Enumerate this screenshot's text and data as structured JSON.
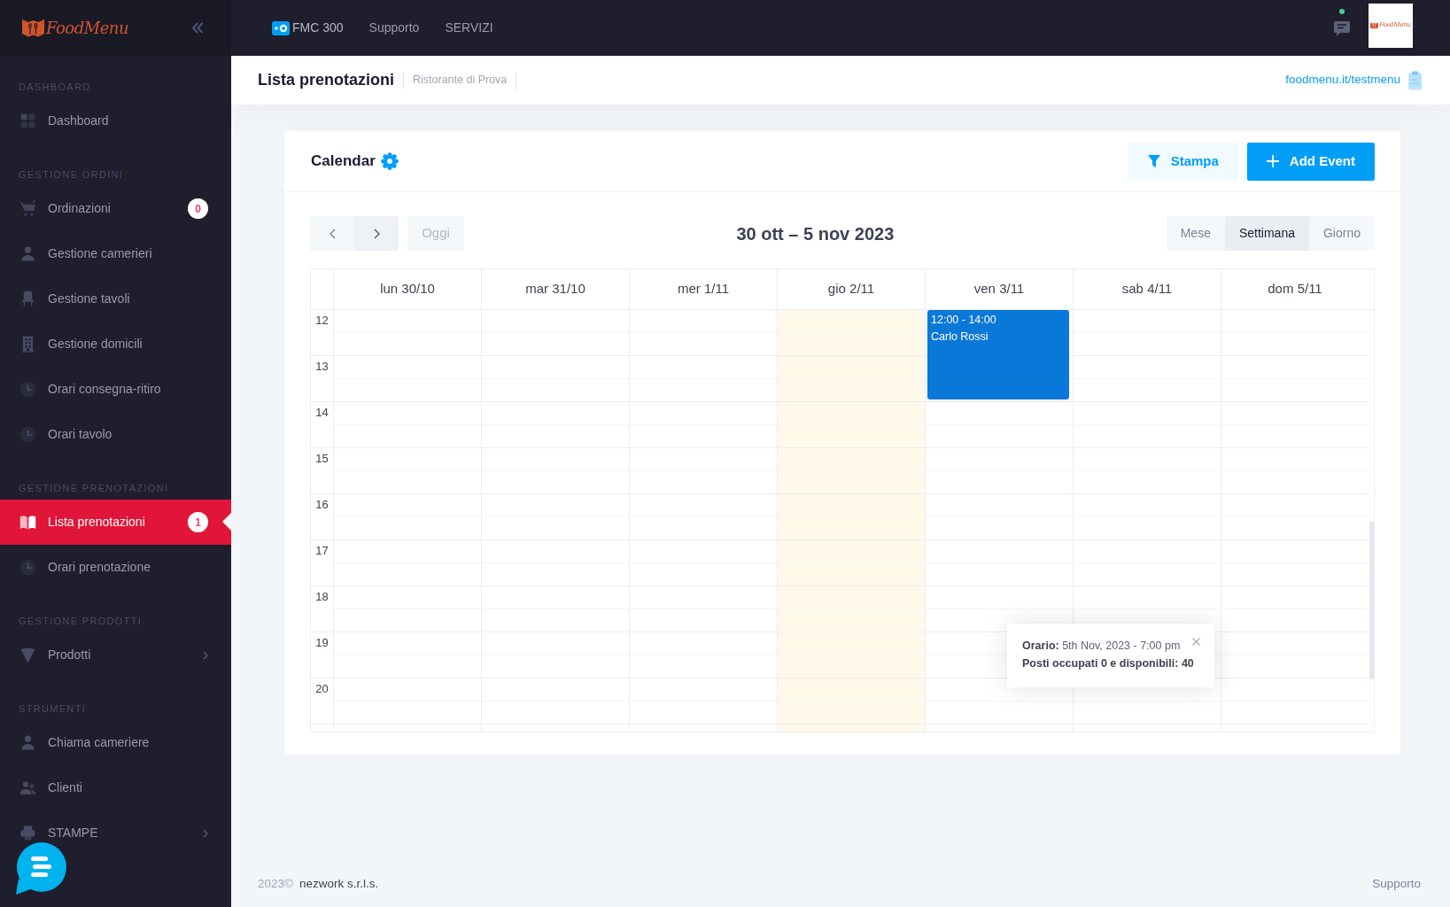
{
  "sidebar": {
    "logo": "FoodMenu",
    "sections": [
      {
        "label": "DASHBOARD",
        "items": [
          {
            "label": "Dashboard",
            "selected": false,
            "has_submenu": false
          }
        ]
      },
      {
        "label": "GESTIONE ORDINI",
        "items": [
          {
            "label": "Ordinazioni",
            "badge": "0",
            "selected": false,
            "has_submenu": false
          },
          {
            "label": "Gestione camerieri",
            "selected": false,
            "has_submenu": false
          },
          {
            "label": "Gestione tavoli",
            "selected": false,
            "has_submenu": false
          },
          {
            "label": "Gestione domicili",
            "selected": false,
            "has_submenu": false
          },
          {
            "label": "Orari consegna-ritiro",
            "selected": false,
            "has_submenu": false
          },
          {
            "label": "Orari tavolo",
            "selected": false,
            "has_submenu": false
          }
        ]
      },
      {
        "label": "GESTIONE PRENOTAZIONI",
        "items": [
          {
            "label": "Lista prenotazioni",
            "badge": "1",
            "selected": true,
            "has_submenu": false
          },
          {
            "label": "Orari prenotazione",
            "selected": false,
            "has_submenu": false
          }
        ]
      },
      {
        "label": "GESTIONE PRODOTTI",
        "items": [
          {
            "label": "Prodotti",
            "selected": false,
            "has_submenu": true
          }
        ]
      },
      {
        "label": "STRUMENTI",
        "items": [
          {
            "label": "Chiama cameriere",
            "selected": false,
            "has_submenu": false
          },
          {
            "label": "Clienti",
            "selected": false,
            "has_submenu": false
          },
          {
            "label": "STAMPE",
            "selected": false,
            "has_submenu": true
          }
        ]
      }
    ]
  },
  "topbar": {
    "nav": [
      {
        "label": "FMC 300"
      },
      {
        "label": "Supporto"
      },
      {
        "label": "SERVIZI"
      }
    ],
    "notifications": {
      "unread": true
    },
    "account": {
      "logo": "FoodMenu"
    }
  },
  "page_header": {
    "title": "Lista prenotazioni",
    "subtitle": "Ristorante di Prova",
    "menu_link": "foodmenu.it/testmenu"
  },
  "calendar": {
    "title": "Calendar",
    "buttons": [
      {
        "label": "Stampa",
        "kind": "secondary"
      },
      {
        "label": "Add Event",
        "kind": "primary"
      }
    ],
    "today_button": {
      "label": "Oggi",
      "disabled": true
    },
    "range": "30 ott – 5 nov 2023",
    "views": [
      {
        "label": "Mese",
        "selected": false
      },
      {
        "label": "Settimana",
        "selected": true
      },
      {
        "label": "Giorno",
        "selected": false
      }
    ],
    "days": [
      {
        "label": "lun 30/10",
        "today": false
      },
      {
        "label": "mar 31/10",
        "today": false
      },
      {
        "label": "mer 1/11",
        "today": false
      },
      {
        "label": "gio 2/11",
        "today": true
      },
      {
        "label": "ven 3/11",
        "today": false,
        "events": [
          {
            "time": "12:00 - 14:00",
            "title": "Carlo Rossi"
          }
        ]
      },
      {
        "label": "sab 4/11",
        "today": false
      },
      {
        "label": "dom 5/11",
        "today": false
      }
    ],
    "hours": [
      "12",
      "13",
      "14",
      "15",
      "16",
      "17",
      "18",
      "19",
      "20"
    ],
    "popover": {
      "time": "**Orario:** 5th Nov, 2023 - 7:00 pm",
      "seats": "Posti occupati 0 e disponibili: 40"
    }
  },
  "footer": {
    "year": "2023©",
    "company": "nezwork s.r.l.s.",
    "link": "Supporto"
  }
}
